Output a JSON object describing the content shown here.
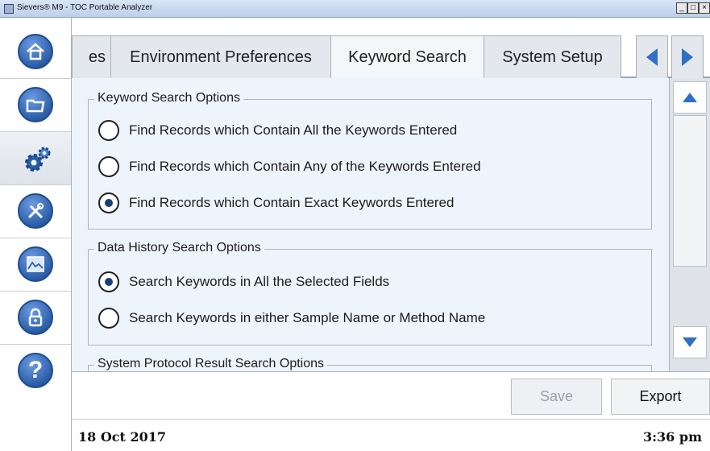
{
  "window": {
    "title": "Sievers® M9 - TOC Portable Analyzer",
    "buttons": [
      "_",
      "□",
      "×"
    ]
  },
  "sidebar": {
    "items": [
      {
        "icon": "home-icon"
      },
      {
        "icon": "folder-icon"
      },
      {
        "icon": "gear-icon"
      },
      {
        "icon": "tools-icon"
      },
      {
        "icon": "chart-icon"
      },
      {
        "icon": "lock-icon"
      },
      {
        "icon": "help-icon"
      }
    ],
    "help_glyph": "?"
  },
  "tabs": [
    {
      "label": "es"
    },
    {
      "label": "Environment Preferences"
    },
    {
      "label": "Keyword Search",
      "active": true
    },
    {
      "label": "System Setup"
    }
  ],
  "colors": {
    "accent": "#2b5ea8",
    "arrow": "#2f6fc7"
  },
  "keyword_options": {
    "title": "Keyword Search Options",
    "options": [
      {
        "label": "Find Records which Contain All the Keywords Entered",
        "checked": false
      },
      {
        "label": "Find Records which Contain Any of the Keywords Entered",
        "checked": false
      },
      {
        "label": "Find Records which Contain Exact Keywords Entered",
        "checked": true
      }
    ]
  },
  "history_options": {
    "title": "Data History Search Options",
    "options": [
      {
        "label": "Search Keywords in All the Selected Fields",
        "checked": true
      },
      {
        "label": "Search Keywords in either Sample Name or Method Name",
        "checked": false
      }
    ]
  },
  "protocol_options": {
    "title": "System Protocol Result Search Options"
  },
  "buttons": {
    "save": "Save",
    "export": "Export"
  },
  "status": {
    "date": "18 Oct 2017",
    "time": "3:36 pm"
  }
}
